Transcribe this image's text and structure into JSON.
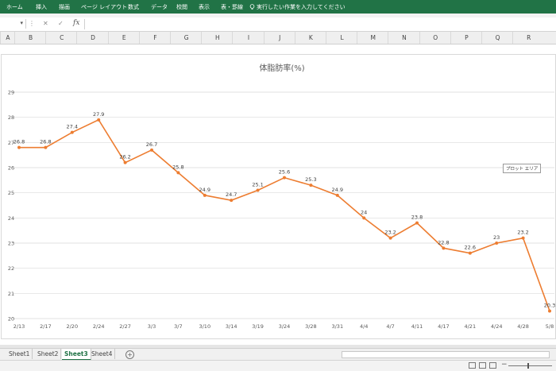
{
  "ribbon": {
    "tabs": [
      "ホーム",
      "挿入",
      "描画",
      "ページ レイアウト",
      "数式",
      "データ",
      "校閲",
      "表示",
      "表・罫線"
    ],
    "tell_me": "実行したい作業を入力してください"
  },
  "formula_bar": {
    "fx_label": "fx"
  },
  "columns": [
    "A",
    "B",
    "C",
    "D",
    "E",
    "F",
    "G",
    "H",
    "I",
    "J",
    "K",
    "L",
    "M",
    "N",
    "O",
    "P",
    "Q",
    "R"
  ],
  "chart_data": {
    "type": "line",
    "title": "体脂肪率(%)",
    "x": [
      "2/13",
      "2/17",
      "2/20",
      "2/24",
      "2/27",
      "3/3",
      "3/7",
      "3/10",
      "3/14",
      "3/19",
      "3/24",
      "3/28",
      "3/31",
      "4/4",
      "4/7",
      "4/11",
      "4/17",
      "4/21",
      "4/24",
      "4/28",
      "5/8"
    ],
    "values": [
      26.8,
      26.8,
      27.4,
      27.9,
      26.2,
      26.7,
      25.8,
      24.9,
      24.7,
      25.1,
      25.6,
      25.3,
      24.9,
      24.0,
      23.2,
      23.8,
      22.8,
      22.6,
      23.0,
      23.2,
      20.3
    ],
    "data_labels": [
      "26.8",
      "26.8",
      "27.4",
      "27.9",
      "26.2",
      "26.7",
      "25.8",
      "24.9",
      "24.7",
      "25.1",
      "25.6",
      "25.3",
      "24.9",
      "24",
      "23.2",
      "23.8",
      "22.8",
      "22.6",
      "23",
      "23.2",
      "20.3"
    ],
    "yticks": [
      "20",
      "21",
      "22",
      "23",
      "24",
      "25",
      "26",
      "27",
      "28",
      "29"
    ],
    "ylim": [
      20,
      29
    ],
    "grid": true,
    "line_color": "#ed7d31"
  },
  "tooltip": "プロット エリア",
  "sheet_tabs": [
    "Sheet1",
    "Sheet2",
    "Sheet3",
    "Sheet4"
  ],
  "active_sheet": "Sheet3",
  "colors": {
    "ribbon": "#217346",
    "series": "#ed7d31",
    "grid": "#d9d9d9"
  }
}
